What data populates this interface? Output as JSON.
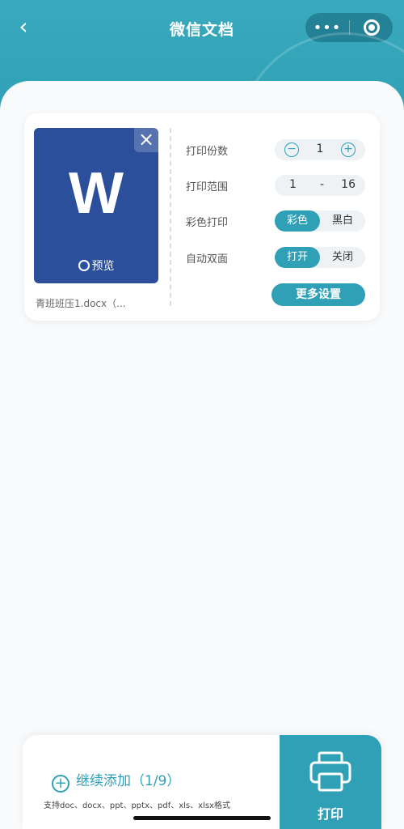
{
  "header": {
    "back_icon": "chevron-left-icon",
    "title": "微信文档",
    "more_icon": "more-dots-icon",
    "close_icon": "target-icon"
  },
  "file_card": {
    "thumb_letter": "W",
    "preview_label": "预览",
    "close_icon": "close-icon",
    "filename": "青班班压1.docx（...",
    "settings": {
      "copies_label": "打印份数",
      "copies_value": "1",
      "range_label": "打印范围",
      "range_from": "1",
      "range_sep": "-",
      "range_to": "16",
      "color_label": "彩色打印",
      "color_on": "彩色",
      "color_off": "黑白",
      "duplex_label": "自动双面",
      "duplex_on": "打开",
      "duplex_off": "关闭",
      "more_settings": "更多设置"
    }
  },
  "bottom_bar": {
    "add_label": "继续添加",
    "add_count": "（1/9）",
    "formats": "支持doc、docx、ppt、pptx、pdf、xls、xlsx格式",
    "print_label": "打印"
  },
  "colors": {
    "accent": "#2fa0b6",
    "doc_blue": "#2c4f9c"
  }
}
